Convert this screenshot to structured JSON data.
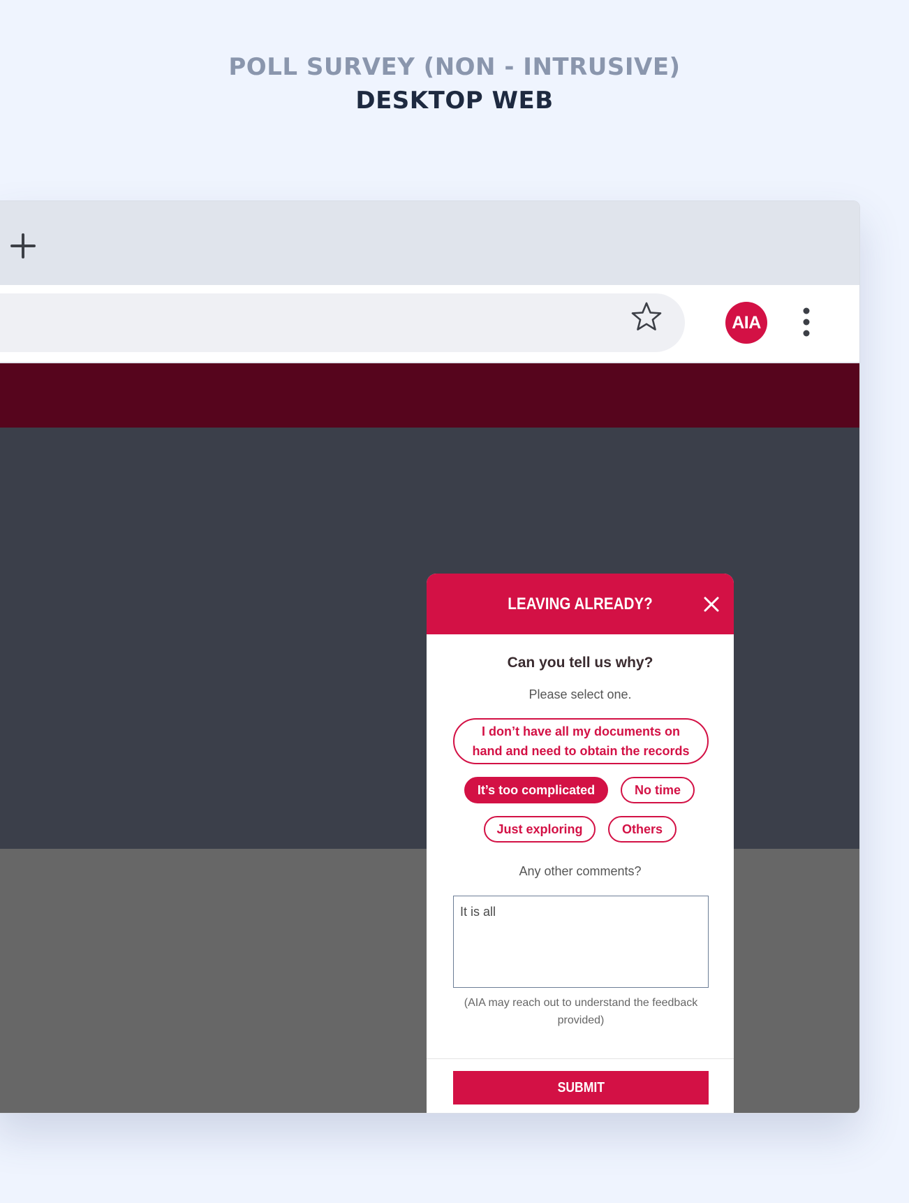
{
  "page": {
    "heading_line1": "POLL SURVEY (NON - INTRUSIVE)",
    "heading_line2": "DESKTOP WEB"
  },
  "browser": {
    "new_tab_icon": "plus-icon",
    "bookmark_icon": "star-icon",
    "profile_avatar": "AIA",
    "menu_icon": "vertical-dots-icon"
  },
  "modal": {
    "title": "LEAVING ALREADY?",
    "close_icon": "close-icon",
    "question": "Can you tell us why?",
    "instruction": "Please select one.",
    "options": [
      {
        "label": "I don’t have all my documents on hand and need to obtain the records",
        "selected": false
      },
      {
        "label": "It’s too complicated",
        "selected": true
      },
      {
        "label": "No time",
        "selected": false
      },
      {
        "label": "Just exploring",
        "selected": false
      },
      {
        "label": "Others",
        "selected": false
      }
    ],
    "comments_label": "Any other comments?",
    "comments_value": "It is all",
    "disclaimer": "(AIA may reach out to understand the feedback provided)",
    "submit_label": "SUBMIT"
  },
  "colors": {
    "background": "#eff4fe",
    "brand_red": "#d31145",
    "site_header": "#56051d",
    "site_dark": "#3b3f4a",
    "site_gray": "#676767"
  }
}
